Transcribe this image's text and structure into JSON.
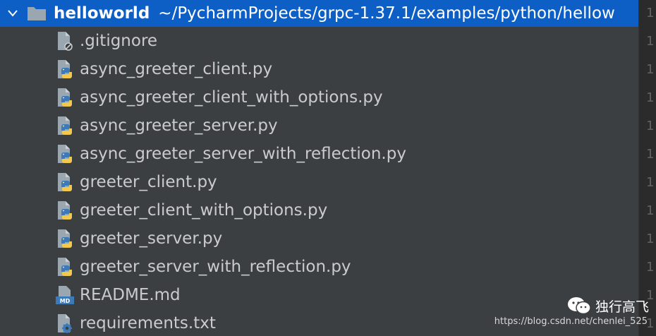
{
  "project_tree": {
    "root": {
      "name": "helloworld",
      "path": "~/PycharmProjects/grpc-1.37.1/examples/python/hellow"
    },
    "files": [
      {
        "name": ".gitignore",
        "icon": "gitignore-file-icon"
      },
      {
        "name": "async_greeter_client.py",
        "icon": "python-file-icon"
      },
      {
        "name": "async_greeter_client_with_options.py",
        "icon": "python-file-icon"
      },
      {
        "name": "async_greeter_server.py",
        "icon": "python-file-icon"
      },
      {
        "name": "async_greeter_server_with_reflection.py",
        "icon": "python-file-icon"
      },
      {
        "name": "greeter_client.py",
        "icon": "python-file-icon"
      },
      {
        "name": "greeter_client_with_options.py",
        "icon": "python-file-icon"
      },
      {
        "name": "greeter_server.py",
        "icon": "python-file-icon"
      },
      {
        "name": "greeter_server_with_reflection.py",
        "icon": "python-file-icon"
      },
      {
        "name": "README.md",
        "icon": "markdown-file-icon"
      },
      {
        "name": "requirements.txt",
        "icon": "requirements-file-icon"
      }
    ]
  },
  "gutter": {
    "digits": [
      "1",
      "1",
      "1",
      "1",
      "1",
      "1",
      "1",
      "1",
      "1",
      "1",
      "1",
      "1"
    ]
  },
  "watermark": {
    "title": "独行高飞",
    "url": "https://blog.csdn.net/chenlei_525"
  },
  "colors": {
    "background": "#3c3f41",
    "selection": "#0d5fc5",
    "file_text": "#c9cbcd",
    "gutter": "#2b2b2b"
  }
}
